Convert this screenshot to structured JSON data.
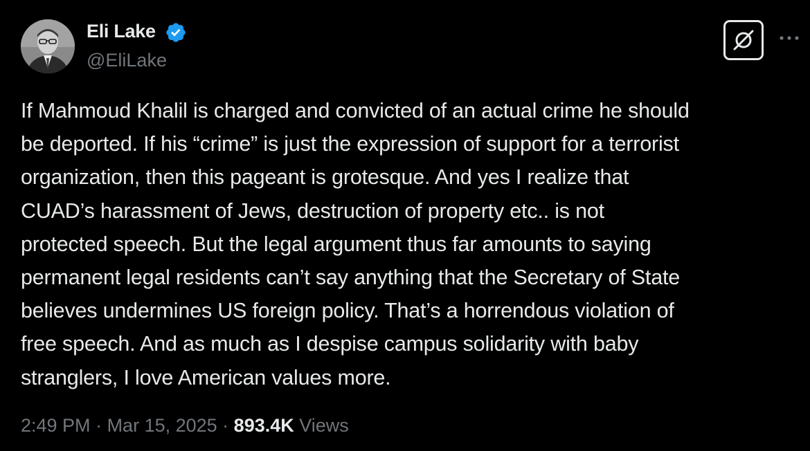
{
  "author": {
    "name": "Eli Lake",
    "handle": "@EliLake",
    "verified": true,
    "verified_color": "#1d9bf0"
  },
  "actions": {
    "grok_icon": "grok-icon",
    "more_icon": "more-horizontal-icon"
  },
  "tweet": {
    "lines": [
      "If Mahmoud Khalil is charged and convicted of an actual crime he should",
      "be deported. If his “crime” is just the expression of support for a terrorist",
      "organization, then this pageant is grotesque.  And yes I realize that",
      "CUAD’s harassment of Jews, destruction of property etc.. is not",
      "protected speech.  But the legal argument thus far amounts to saying",
      "permanent legal residents can’t say anything that the Secretary of State",
      "believes undermines US foreign policy. That’s a horrendous violation of",
      "free speech. And as much as I despise campus solidarity with baby",
      "stranglers, I love American values more."
    ]
  },
  "meta": {
    "time": "2:49 PM",
    "separator": " · ",
    "date": "Mar 15, 2025",
    "views_count": "893.4K",
    "views_label": " Views"
  },
  "colors": {
    "background": "#000000",
    "text": "#e7e9ea",
    "secondary": "#71767b"
  }
}
